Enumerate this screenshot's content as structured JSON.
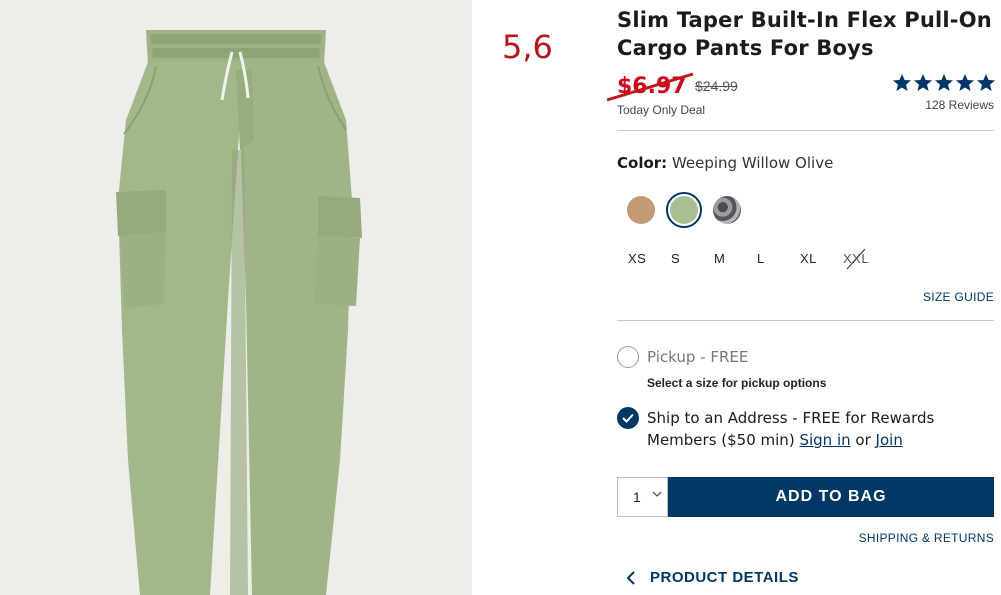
{
  "annotation": "5,6",
  "product": {
    "title": "Slim Taper Built-In Flex Pull-On Cargo Pants For Boys",
    "sale_price": "$6.97",
    "original_price": "$24.99",
    "deal_text": "Today Only Deal",
    "rating_stars": 5,
    "reviews_label": "128 Reviews",
    "image_icon": "cargo-pants-photo"
  },
  "color": {
    "label": "Color:",
    "selected_name": "Weeping Willow Olive",
    "swatches": [
      {
        "name": "tan",
        "hex": "#c49a76",
        "selected": false
      },
      {
        "name": "weeping-willow-olive",
        "hex": "#a9bf93",
        "selected": true
      },
      {
        "name": "camo-grey",
        "hex": "#6b6e74",
        "selected": false
      }
    ]
  },
  "sizes": [
    "XS",
    "S",
    "M",
    "L",
    "XL",
    "XXL"
  ],
  "size_guide": "SIZE GUIDE",
  "fulfillment": {
    "pickup_label": "Pickup - FREE",
    "pickup_sub": "Select a size for pickup options",
    "ship_text_1": "Ship to an Address - FREE for Rewards",
    "ship_text_2": "Members ($50 min)",
    "sign_in": "Sign in",
    "or": "or",
    "join": "Join"
  },
  "cart": {
    "quantity": "1",
    "add_button": "ADD TO BAG"
  },
  "shipping_returns": "SHIPPING & RETURNS",
  "product_details": "PRODUCT DETAILS",
  "colors": {
    "navy": "#003764",
    "sale_red": "#d0021b",
    "annotation_red": "#b3171c",
    "pants_green": "#a3b88a"
  }
}
